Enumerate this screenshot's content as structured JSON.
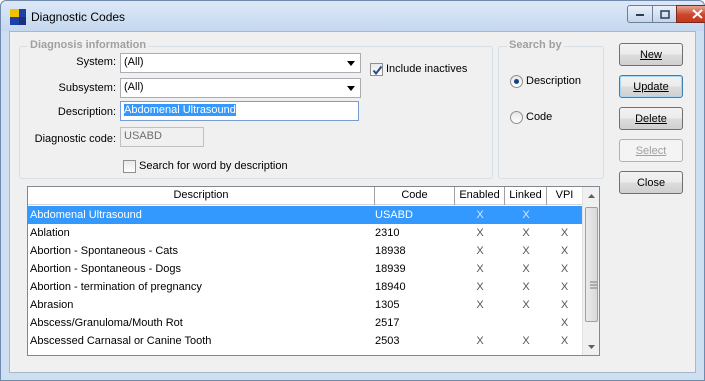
{
  "window": {
    "title": "Diagnostic Codes",
    "icon": "app-flag-icon"
  },
  "diagnosis_group": {
    "title": "Diagnosis information",
    "system_label": "System:",
    "system_value": "(All)",
    "subsystem_label": "Subsystem:",
    "subsystem_value": "(All)",
    "include_inactives_label": "Include inactives",
    "include_inactives_checked": true,
    "description_label": "Description:",
    "description_value": "Abdomenal Ultrasound",
    "diagnostic_code_label": "Diagnostic code:",
    "diagnostic_code_value": "USABD",
    "search_word_label": "Search for word by description",
    "search_word_checked": false
  },
  "search_by": {
    "title": "Search by",
    "options": [
      "Description",
      "Code"
    ],
    "selected": "Description"
  },
  "buttons": {
    "new": "New",
    "update": "Update",
    "delete": "Delete",
    "select": "Select",
    "close": "Close"
  },
  "table": {
    "columns": [
      "Description",
      "Code",
      "Enabled",
      "Linked",
      "VPI"
    ],
    "selected_index": 0,
    "rows": [
      {
        "description": "Abdomenal Ultrasound",
        "code": "USABD",
        "enabled": "X",
        "linked": "X",
        "vpi": ""
      },
      {
        "description": "Ablation",
        "code": "2310",
        "enabled": "X",
        "linked": "X",
        "vpi": "X"
      },
      {
        "description": "Abortion - Spontaneous - Cats",
        "code": "18938",
        "enabled": "X",
        "linked": "X",
        "vpi": "X"
      },
      {
        "description": "Abortion - Spontaneous - Dogs",
        "code": "18939",
        "enabled": "X",
        "linked": "X",
        "vpi": "X"
      },
      {
        "description": "Abortion - termination of pregnancy",
        "code": "18940",
        "enabled": "X",
        "linked": "X",
        "vpi": "X"
      },
      {
        "description": "Abrasion",
        "code": "1305",
        "enabled": "X",
        "linked": "X",
        "vpi": "X"
      },
      {
        "description": "Abscess/Granuloma/Mouth Rot",
        "code": "2517",
        "enabled": "",
        "linked": "",
        "vpi": "X"
      },
      {
        "description": "Abscessed Carnasal or Canine Tooth",
        "code": "2503",
        "enabled": "X",
        "linked": "X",
        "vpi": "X"
      }
    ]
  },
  "colors": {
    "selection": "#3399ff",
    "window_frame": "#cfdff2",
    "client_bg": "#f0f0f0"
  }
}
